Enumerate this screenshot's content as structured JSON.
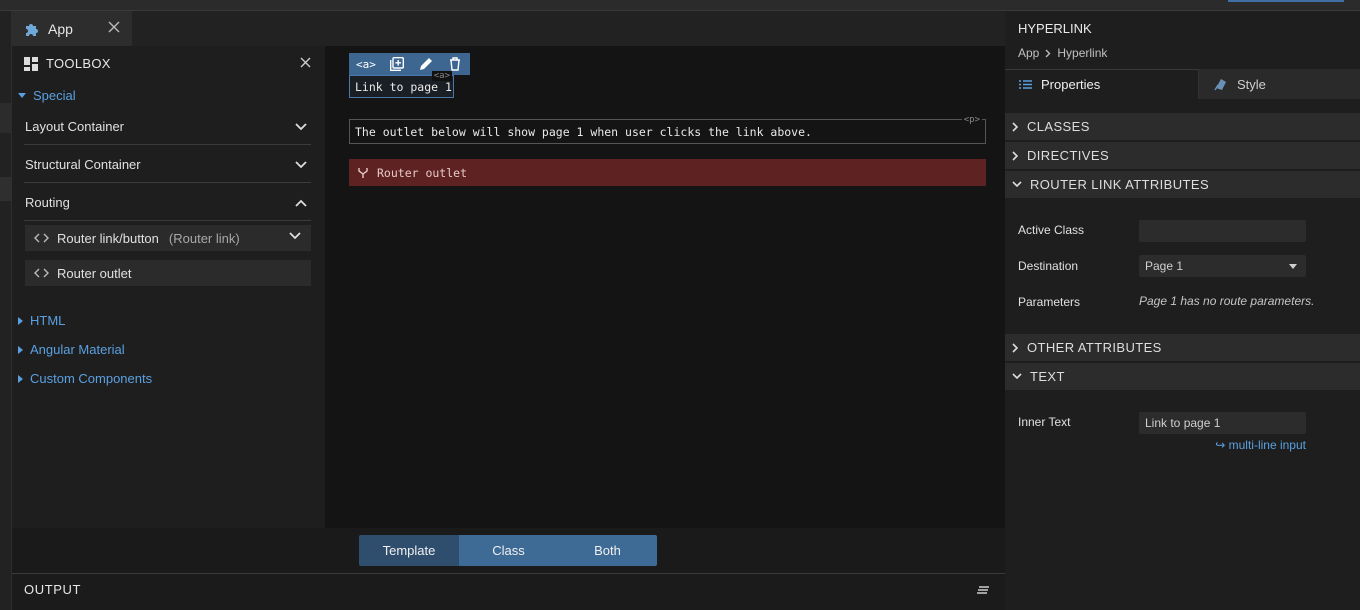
{
  "tab": {
    "label": "App"
  },
  "toolbox": {
    "title": "TOOLBOX",
    "special_label": "Special",
    "groups": [
      {
        "label": "Layout Container"
      },
      {
        "label": "Structural Container"
      },
      {
        "label": "Routing"
      }
    ],
    "routing_items": [
      {
        "label": "Router link/button",
        "sub": "(Router link)"
      },
      {
        "label": "Router outlet"
      }
    ],
    "sections": [
      {
        "label": "HTML"
      },
      {
        "label": "Angular Material"
      },
      {
        "label": "Custom Components"
      }
    ]
  },
  "canvas": {
    "a_tag": "<a>",
    "link_text": "Link to page 1",
    "a_hint": "<a>",
    "p_hint": "<p>",
    "paragraph_text": "The outlet below will show page 1 when user clicks the link above.",
    "outlet_label": "Router outlet"
  },
  "view_toggle": {
    "template": "Template",
    "class": "Class",
    "both": "Both",
    "active": "Template"
  },
  "output": {
    "label": "OUTPUT"
  },
  "panel": {
    "title": "HYPERLINK",
    "breadcrumb": [
      "App",
      "Hyperlink"
    ],
    "tabs": {
      "properties": "Properties",
      "style": "Style"
    },
    "sections": {
      "classes": "CLASSES",
      "directives": "DIRECTIVES",
      "router_link": "ROUTER LINK ATTRIBUTES",
      "other": "OTHER ATTRIBUTES",
      "text": "TEXT"
    },
    "router_link": {
      "active_class_label": "Active Class",
      "active_class_value": "",
      "destination_label": "Destination",
      "destination_value": "Page 1",
      "parameters_label": "Parameters",
      "parameters_note": "Page 1 has no route parameters."
    },
    "text": {
      "inner_text_label": "Inner Text",
      "inner_text_value": "Link to page 1",
      "multiline_link": "↪ multi-line input"
    }
  },
  "colors": {
    "accent": "#5aa0e0",
    "selection": "#3d6691",
    "outlet": "#5e2222",
    "toggle_active": "#2f4e6e",
    "toggle_inactive": "#3e6a96"
  }
}
